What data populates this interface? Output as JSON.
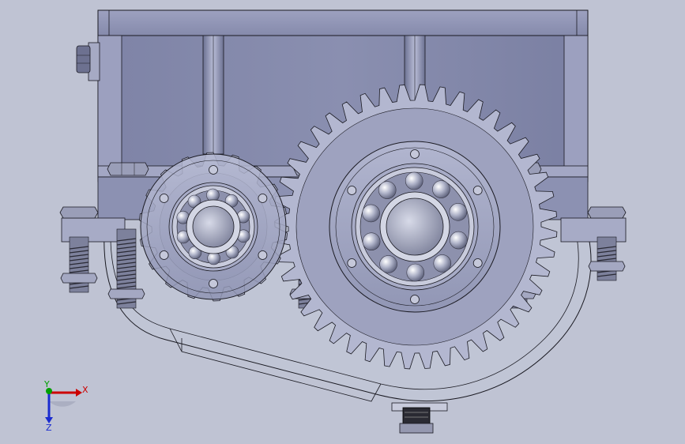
{
  "viewport": {
    "background": "#bfc3d3",
    "model_color": "#8e92b4",
    "edge_color": "#1a1a22"
  },
  "triad": {
    "x_label": "X",
    "y_label": "Y",
    "z_label": "Z",
    "x_color": "#cc0000",
    "y_color": "#00a000",
    "z_color": "#1a2bd0"
  },
  "model": {
    "gears": [
      {
        "name": "pinion",
        "teeth": 18
      },
      {
        "name": "driven-gear",
        "teeth": 44
      }
    ],
    "bearings": [
      {
        "name": "input-bearing",
        "balls": 10
      },
      {
        "name": "output-bearing",
        "balls": 10
      }
    ]
  }
}
